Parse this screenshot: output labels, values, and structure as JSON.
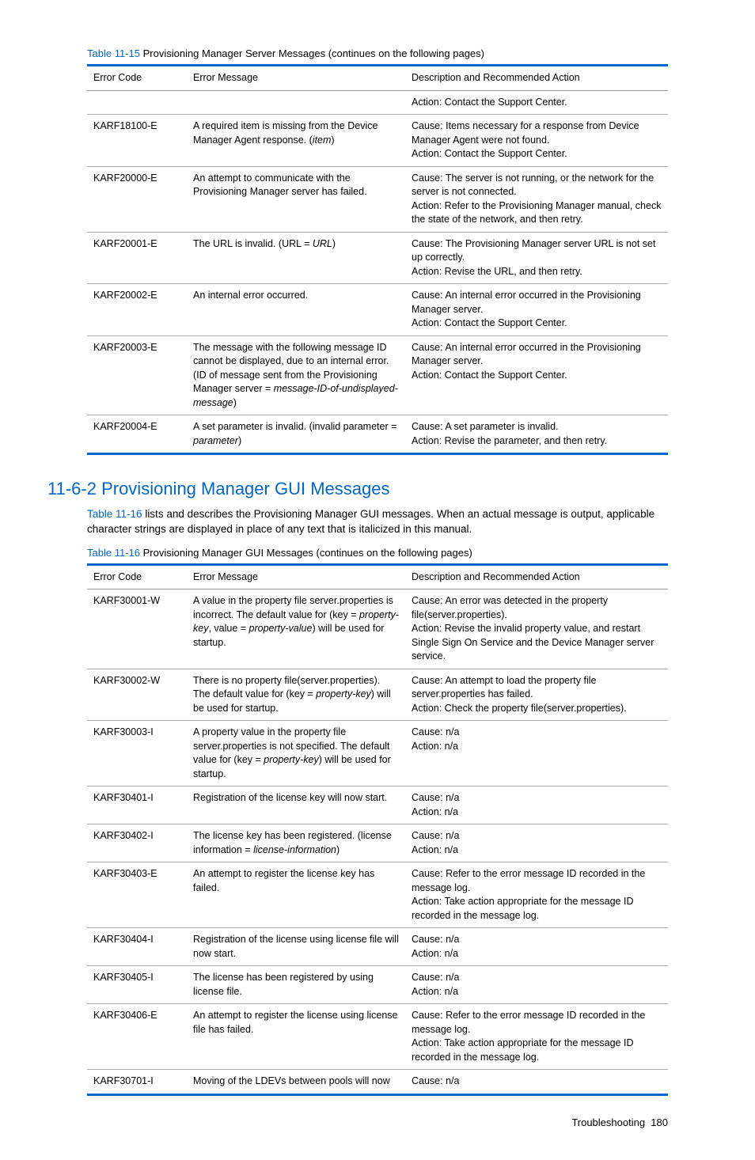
{
  "table15": {
    "captionLink": "Table 11-15",
    "captionRest": " Provisioning Manager Server Messages (continues on the following pages)",
    "headers": [
      "Error Code",
      "Error Message",
      "Description and Recommended Action"
    ],
    "rows": [
      {
        "code": "",
        "msg": [],
        "desc": [
          "Action: Contact the Support Center."
        ],
        "continuation": true
      },
      {
        "code": "KARF18100-E",
        "msg": [
          "A required item is missing from the Device Manager Agent response. (",
          {
            "i": "item"
          },
          ")"
        ],
        "desc": [
          "Cause: Items necessary for a response from Device Manager Agent were not found.",
          "Action: Contact the Support Center."
        ]
      },
      {
        "code": "KARF20000-E",
        "msg": [
          "An attempt to communicate with the Provisioning Manager server has failed."
        ],
        "desc": [
          "Cause: The server is not running, or the network for the server is not connected.",
          "Action: Refer to the Provisioning Manager manual, check the state of the network, and then retry."
        ]
      },
      {
        "code": "KARF20001-E",
        "msg": [
          "The URL is invalid. (URL = ",
          {
            "i": "URL"
          },
          ")"
        ],
        "desc": [
          "Cause: The Provisioning Manager server URL is not set up correctly.",
          "Action: Revise the URL, and then retry."
        ]
      },
      {
        "code": "KARF20002-E",
        "msg": [
          "An internal error occurred."
        ],
        "desc": [
          "Cause: An internal error occurred in the Provisioning Manager server.",
          "Action: Contact the Support Center."
        ]
      },
      {
        "code": "KARF20003-E",
        "msg": [
          "The message with the following message ID cannot be displayed, due to an internal error. (ID of message sent from the Provisioning Manager server = ",
          {
            "i": "message-ID-of-undisplayed-message"
          },
          ")"
        ],
        "desc": [
          "Cause: An internal error occurred in the Provisioning Manager server.",
          "Action: Contact the Support Center."
        ]
      },
      {
        "code": "KARF20004-E",
        "msg": [
          "A set parameter is invalid. (invalid parameter = ",
          {
            "i": "parameter"
          },
          ")"
        ],
        "desc": [
          "Cause: A set parameter is invalid.",
          "Action: Revise the parameter, and then retry."
        ]
      }
    ]
  },
  "section": {
    "heading": "11-6-2 Provisioning Manager GUI Messages",
    "paraLink": "Table 11-16",
    "paraRest": " lists and describes the Provisioning Manager GUI messages. When an actual message is output, applicable character strings are displayed in place of any text that is italicized in this manual."
  },
  "table16": {
    "captionLink": "Table 11-16",
    "captionRest": " Provisioning Manager GUI Messages (continues on the following pages)",
    "headers": [
      "Error Code",
      "Error Message",
      "Description and Recommended Action"
    ],
    "rows": [
      {
        "code": "KARF30001-W",
        "msg": [
          "A value in the property file server.properties is incorrect. The default value for (key = ",
          {
            "i": "property-key"
          },
          ", value = ",
          {
            "i": "property-value"
          },
          ") will be used for startup."
        ],
        "desc": [
          "Cause: An error was detected in the property file(server.properties).",
          "Action: Revise the invalid property value, and restart Single Sign On Service and the Device Manager server service."
        ]
      },
      {
        "code": "KARF30002-W",
        "msg": [
          "There is no property file(server.properties). The default value for (key = ",
          {
            "i": "property-key"
          },
          ") will be used for startup."
        ],
        "desc": [
          "Cause: An attempt to load the property file server.properties has failed.",
          "Action: Check the property file(server.properties)."
        ]
      },
      {
        "code": "KARF30003-I",
        "msg": [
          "A property value in the property file server.properties is not specified. The default value for (key = ",
          {
            "i": "property-key"
          },
          ") will be used for startup."
        ],
        "desc": [
          "Cause: n/a",
          "Action: n/a"
        ]
      },
      {
        "code": "KARF30401-I",
        "msg": [
          "Registration of the license key will now start."
        ],
        "desc": [
          "Cause: n/a",
          "Action: n/a"
        ]
      },
      {
        "code": "KARF30402-I",
        "msg": [
          "The license key has been registered. (license information = ",
          {
            "i": "license-information"
          },
          ")"
        ],
        "desc": [
          "Cause: n/a",
          "Action: n/a"
        ]
      },
      {
        "code": "KARF30403-E",
        "msg": [
          "An attempt to register the license key has failed."
        ],
        "desc": [
          "Cause: Refer to the error message ID recorded in the message log.",
          "Action: Take action appropriate for the message ID recorded in the message log."
        ]
      },
      {
        "code": "KARF30404-I",
        "msg": [
          "Registration of the license using license file will now start."
        ],
        "desc": [
          "Cause: n/a",
          "Action: n/a"
        ]
      },
      {
        "code": "KARF30405-I",
        "msg": [
          "The license has been registered by using license file."
        ],
        "desc": [
          "Cause: n/a",
          "Action: n/a"
        ]
      },
      {
        "code": "KARF30406-E",
        "msg": [
          "An attempt to register the license using license file has failed."
        ],
        "desc": [
          "Cause: Refer to the error message ID recorded in the message log.",
          "Action: Take action appropriate for the message ID recorded in the message log."
        ]
      },
      {
        "code": "KARF30701-I",
        "msg": [
          "Moving of the LDEVs between pools will now"
        ],
        "desc": [
          "Cause: n/a"
        ]
      }
    ]
  },
  "footer": {
    "label": "Troubleshooting",
    "page": "180"
  }
}
